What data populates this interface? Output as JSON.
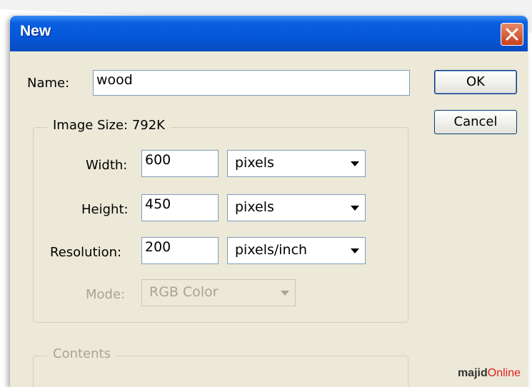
{
  "dialog": {
    "title": "New",
    "name_label": "Name:",
    "name_value": "wood",
    "image_size_label": "Image Size: 792K",
    "width_label": "Width:",
    "width_value": "600",
    "width_unit": "pixels",
    "height_label": "Height:",
    "height_value": "450",
    "height_unit": "pixels",
    "resolution_label": "Resolution:",
    "resolution_value": "200",
    "resolution_unit": "pixels/inch",
    "mode_label": "Mode:",
    "mode_value": "RGB Color",
    "contents_label": "Contents"
  },
  "buttons": {
    "ok": "OK",
    "cancel": "Cancel"
  },
  "watermark": {
    "part1": "majid",
    "part2": "Online"
  },
  "colors": {
    "titlebar": "#0457d8",
    "dialog_bg": "#ece9d8",
    "close_button": "#c8401a",
    "watermark_accent": "#e0201c"
  },
  "icons": {
    "close": "close-icon",
    "dropdown": "chevron-down-icon"
  }
}
